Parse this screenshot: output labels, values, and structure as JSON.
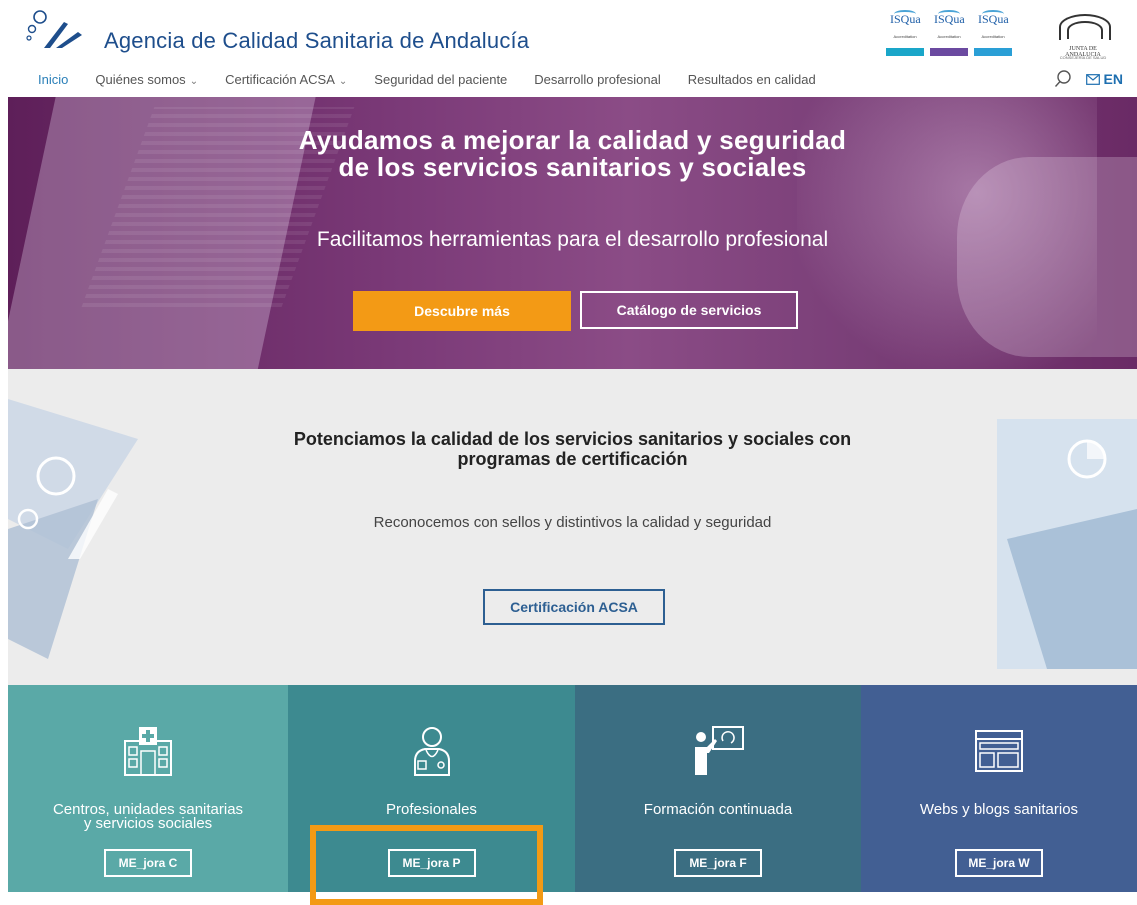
{
  "header": {
    "title": "Agencia de Calidad Sanitaria de Andalucía",
    "badges": [
      {
        "name": "ISQua",
        "sub": "Accreditation",
        "bar_color": "#1aa6c9"
      },
      {
        "name": "ISQua",
        "sub": "Accreditation",
        "bar_color": "#6b4aa0"
      },
      {
        "name": "ISQua",
        "sub": "Accreditation",
        "bar_color": "#2a9fd6"
      }
    ],
    "junta_name": "JUNTA DE ANDALUCIA",
    "junta_sub": "CONSEJERÍA DE SALUD"
  },
  "nav": {
    "items": [
      {
        "label": "Inicio",
        "active": true,
        "dropdown": false
      },
      {
        "label": "Quiénes somos",
        "active": false,
        "dropdown": true
      },
      {
        "label": "Certificación ACSA",
        "active": false,
        "dropdown": true
      },
      {
        "label": "Seguridad del paciente",
        "active": false,
        "dropdown": false
      },
      {
        "label": "Desarrollo profesional",
        "active": false,
        "dropdown": false
      },
      {
        "label": "Resultados en calidad",
        "active": false,
        "dropdown": false
      }
    ],
    "lang": "EN",
    "chevron": "⌄"
  },
  "hero": {
    "title_line1": "Ayudamos a mejorar la calidad y seguridad",
    "title_line2": "de los servicios sanitarios y sociales",
    "subtitle": "Facilitamos herramientas para el desarrollo profesional",
    "primary_btn": "Descubre más",
    "secondary_btn": "Catálogo de servicios"
  },
  "cert": {
    "title_line1": "Potenciamos la calidad de los servicios sanitarios y sociales con",
    "title_line2": "programas de certificación",
    "subtitle": "Reconocemos con sellos y distintivos la calidad y seguridad",
    "button": "Certificación ACSA"
  },
  "tiles": [
    {
      "line1": "Centros, unidades sanitarias",
      "line2": "y servicios sociales",
      "button": "ME_jora C",
      "icon": "hospital-icon"
    },
    {
      "line1": "Profesionales",
      "line2": "",
      "button": "ME_jora P",
      "icon": "doctor-icon"
    },
    {
      "line1": "Formación continuada",
      "line2": "",
      "button": "ME_jora F",
      "icon": "teacher-board-icon"
    },
    {
      "line1": "Webs y blogs sanitarios",
      "line2": "",
      "button": "ME_jora W",
      "icon": "browser-window-icon"
    }
  ],
  "colors": {
    "brand_blue": "#1e4e8c",
    "nav_active": "#2a7fb8",
    "orange": "#f39a15",
    "hero_purple": "#7b3a78",
    "tile1": "#5aa9a7",
    "tile2": "#3d8a90",
    "tile3": "#3b6e82",
    "tile4": "#425f93"
  }
}
